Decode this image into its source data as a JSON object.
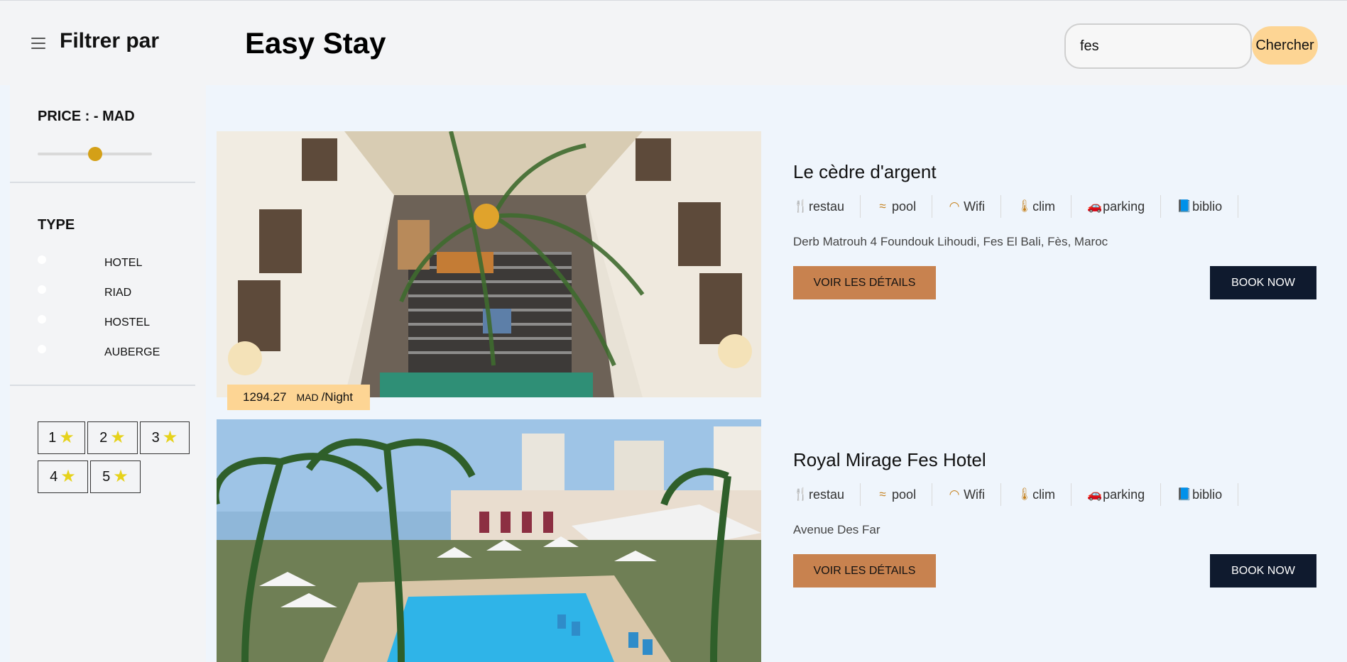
{
  "header": {
    "filter_title": "Filtrer par",
    "brand": "Easy Stay",
    "search_value": "fes",
    "search_button": "Chercher"
  },
  "sidebar": {
    "price_label": "PRICE : - MAD",
    "price_slider_fraction": 0.5,
    "type_label": "TYPE",
    "types": [
      "HOTEL",
      "RIAD",
      "HOSTEL",
      "AUBERGE"
    ],
    "star_filters": [
      "1",
      "2",
      "3",
      "4",
      "5"
    ]
  },
  "amenity_labels": [
    "restau",
    "pool",
    "Wifi",
    "clim",
    "parking",
    "biblio"
  ],
  "amenity_icons": [
    "fork-knife-icon",
    "swimmer-icon",
    "wifi-icon",
    "thermometer-icon",
    "car-icon",
    "book-icon"
  ],
  "listings": [
    {
      "name": "Le cèdre d'argent",
      "address": "Derb Matrouh 4 Foundouk Lihoudi, Fes El Bali, Fès, Maroc",
      "price": "1294.27",
      "currency": "MAD",
      "per": "/Night",
      "details_label": "VOIR LES DÉTAILS",
      "book_label": "BOOK NOW"
    },
    {
      "name": "Royal Mirage Fes Hotel",
      "address": "Avenue Des Far",
      "details_label": "VOIR LES DÉTAILS",
      "book_label": "BOOK NOW"
    }
  ],
  "colors": {
    "accent_yellow": "#fdd594",
    "details_button": "#c8824f",
    "book_button": "#0f1a2e",
    "slider_thumb": "#d4a017",
    "amenity_icon": "#c47f1a"
  }
}
